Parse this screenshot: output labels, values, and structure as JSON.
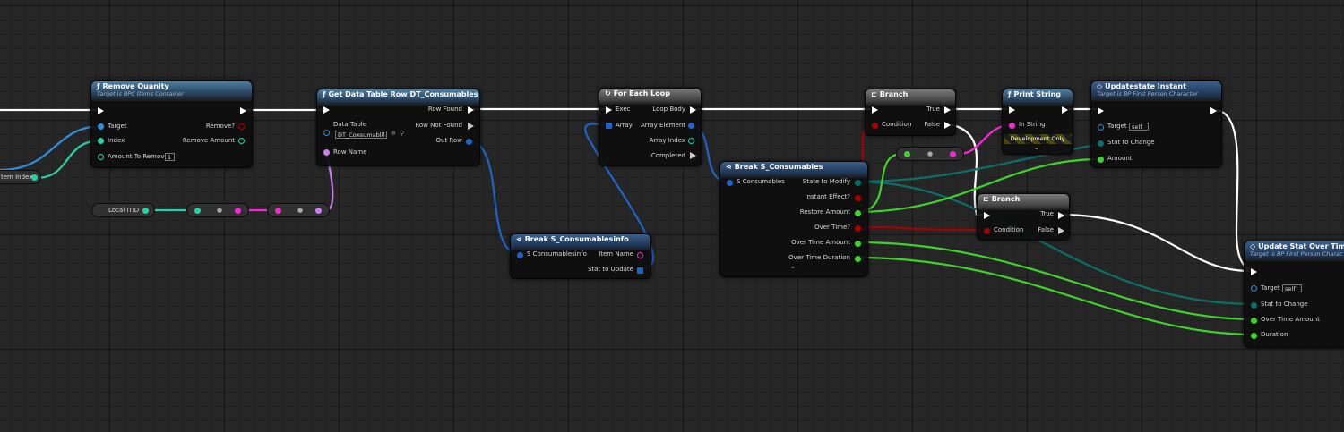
{
  "colors": {
    "exec": "#ffffff",
    "object": "#2f8fd8",
    "int": "#27d1a6",
    "struct": "#1e64c8",
    "string": "#f02bd0",
    "bool": "#a80000",
    "float": "#3fd22a",
    "enum": "#0b6f68",
    "name": "#c97ef0"
  },
  "nodes": {
    "item_index_var": {
      "label": "tem Index"
    },
    "remove_quantity": {
      "title": "Remove Quanity",
      "subtitle": "Target is BPC Items Container",
      "icon": "function-icon",
      "target": "Target",
      "index": "Index",
      "amount_to_remove": "Amount To Remove",
      "amount_value": "1",
      "remove_out": "Remove?",
      "remove_amount_out": "Remove Amount"
    },
    "local_itid": {
      "label": "Local ITID"
    },
    "get_data_table_row": {
      "title": "Get Data Table Row DT_Consumables",
      "icon": "function-icon",
      "data_table": "Data Table",
      "data_table_value": "DT_Consumable",
      "row_name": "Row Name",
      "row_found": "Row Found",
      "row_not_found": "Row Not Found",
      "out_row": "Out Row"
    },
    "break_consumablesinfo": {
      "title": "Break S_Consumablesinfo",
      "icon": "break-icon",
      "input": "S Consumablesinfo",
      "item_name": "Item Name",
      "stat_to_update": "Stat to Update"
    },
    "for_each_loop": {
      "title": "For Each Loop",
      "icon": "loop-icon",
      "exec": "Exec",
      "array": "Array",
      "loop_body": "Loop Body",
      "array_element": "Array Element",
      "array_index": "Array Index",
      "completed": "Completed"
    },
    "break_consumables": {
      "title": "Break S_Consumables",
      "icon": "break-icon",
      "input": "S Consumables",
      "outputs": [
        "State to Modify",
        "Instant Effect?",
        "Restore Amount",
        "Over Time?",
        "Over Time Amount",
        "Over Time Duration"
      ]
    },
    "branch_1": {
      "title": "Branch",
      "condition": "Condition",
      "true": "True",
      "false": "False"
    },
    "branch_2": {
      "title": "Branch",
      "condition": "Condition",
      "true": "True",
      "false": "False"
    },
    "print_string": {
      "title": "Print String",
      "in_string": "In String",
      "dev_only": "Development Only"
    },
    "update_instant": {
      "title": "Updatestate Instant",
      "subtitle": "Target is BP First Person Character",
      "target": "Target",
      "target_value": "self",
      "stat_to_change": "Stat to Change",
      "amount": "Amount"
    },
    "update_over_time": {
      "title": "Update Stat Over Time",
      "subtitle": "Target is BP First Person Charac",
      "target": "Target",
      "target_value": "self",
      "stat_to_change": "Stat to Change",
      "over_time_amount": "Over Time Amount",
      "duration": "Duration"
    }
  }
}
